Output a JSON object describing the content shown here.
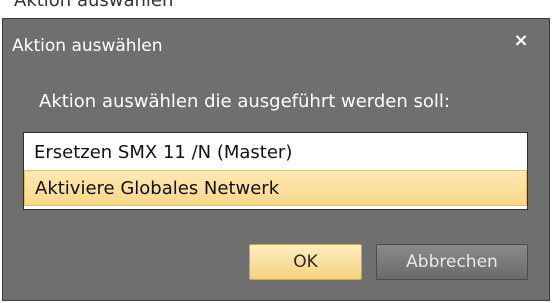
{
  "header": {
    "top_fragment": "Aktion auswählen"
  },
  "dialog": {
    "title": "Aktion auswählen",
    "close_glyph": "×",
    "prompt": "Aktion auswählen die ausgeführt werden soll:",
    "items": [
      {
        "label": "Ersetzen SMX 11 /N (Master)"
      },
      {
        "label": "Aktiviere Globales Netwerk"
      }
    ],
    "buttons": {
      "ok": "OK",
      "cancel": "Abbrechen"
    }
  }
}
